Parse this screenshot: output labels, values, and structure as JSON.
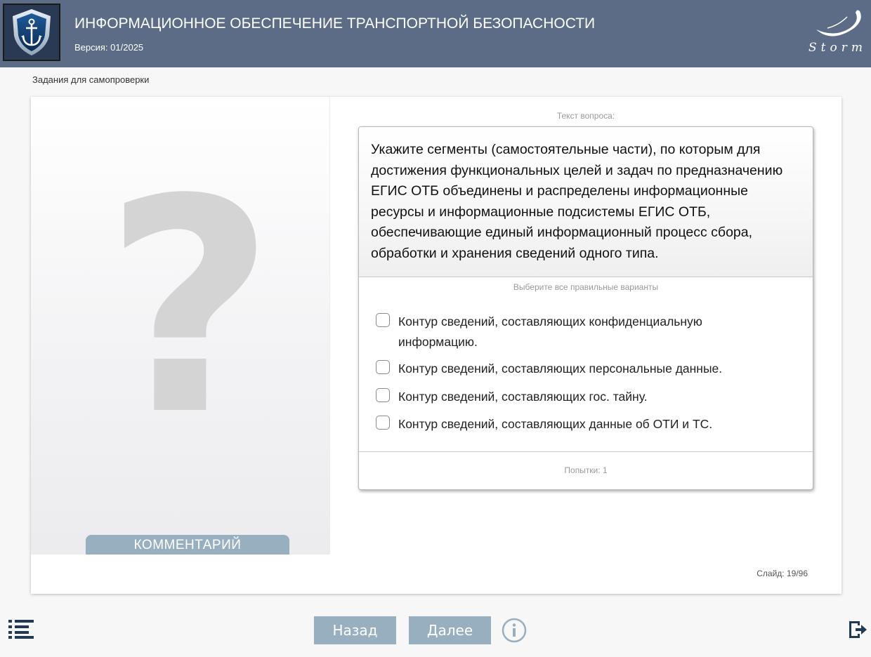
{
  "header": {
    "title": "ИНФОРМАЦИОННОЕ ОБЕСПЕЧЕНИЕ ТРАНСПОРТНОЙ БЕЗОПАСНОСТИ",
    "version": "Версия: 01/2025",
    "brand": "Storm",
    "logo_icon": "anchor-shield-icon"
  },
  "section_label": "Задания для самопроверки",
  "left_panel": {
    "placeholder_glyph": "?",
    "comment_button": "КОММЕНТАРИЙ"
  },
  "question": {
    "caption": "Текст вопроса:",
    "text": "Укажите сегменты (самостоятельные части), по которым для достижения функциональных целей и задач по предназначению ЕГИС ОТБ объединены и распределены информационные ресурсы и информационные подсистемы ЕГИС ОТБ, обеспечивающие единый информационный процесс сбора, обработки и хранения сведений одного типа.",
    "instruction": "Выберите все правильные варианты",
    "options": [
      {
        "label": "Контур сведений, составляющих конфиденциальную информацию.",
        "checked": false
      },
      {
        "label": "Контур сведений, составляющих персональные данные.",
        "checked": false
      },
      {
        "label": "Контур сведений, составляющих гос. тайну.",
        "checked": false
      },
      {
        "label": "Контур сведений, составляющих данные об ОТИ и ТС.",
        "checked": false
      }
    ],
    "attempts": "Попытки: 1"
  },
  "slide_counter": "Слайд: 19/96",
  "nav": {
    "back": "Назад",
    "next": "Далее",
    "menu_icon": "list-icon",
    "info_icon": "info-icon",
    "exit_icon": "exit-icon"
  },
  "colors": {
    "header_bg": "#5c6b86",
    "button_bg": "#97afbf",
    "icon_dark": "#1f3a52"
  }
}
